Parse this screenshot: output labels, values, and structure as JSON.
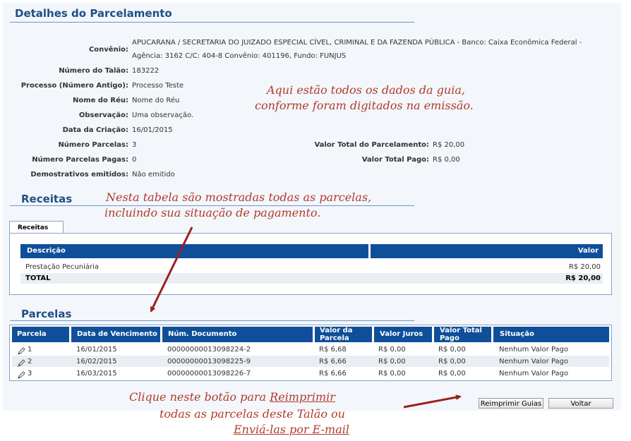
{
  "header": {
    "title": "Detalhes do Parcelamento"
  },
  "details": {
    "convenio_label": "Convênio:",
    "convenio_line1": "APUCARANA / SECRETARIA DO JUIZADO ESPECIAL CÍVEL, CRIMINAL E DA FAZENDA PÚBLICA - Banco: Caixa Econômica Federal -",
    "convenio_line2": "Agência: 3162 C/C: 404-8 Convênio: 401196, Fundo: FUNJUS",
    "talao_label": "Número do Talão:",
    "talao_value": "183222",
    "processo_label": "Processo (Número Antigo):",
    "processo_value": "Processo Teste",
    "reu_label": "Nome do Réu:",
    "reu_value": "Nome do Réu",
    "obs_label": "Observação:",
    "obs_value": "Uma observação.",
    "criacao_label": "Data da Criação:",
    "criacao_value": "16/01/2015",
    "parcelas_label": "Número Parcelas:",
    "parcelas_value": "3",
    "pagas_label": "Número Parcelas Pagas:",
    "pagas_value": "0",
    "demonstrativos_label": "Demostrativos emitidos:",
    "demonstrativos_value": "Não emitido",
    "valor_total_label": "Valor Total do Parcelamento:",
    "valor_total_value": "R$ 20,00",
    "valor_pago_label": "Valor Total Pago:",
    "valor_pago_value": "R$ 0,00"
  },
  "annotations": {
    "note1_line1": "Aqui estão todos os dados da guia,",
    "note1_line2": "conforme foram digitados na emissão.",
    "note2_line1": "Nesta tabela são mostradas todas as parcelas,",
    "note2_line2": "incluindo sua situação de pagamento.",
    "note3_line1": "Clique neste botão para ",
    "note3_line1_u": "Reimprimir",
    "note3_line2": "todas as  parcelas deste Talão ou",
    "note3_line3": "Enviá-las por E-mail",
    "accent": "#b03b2b"
  },
  "receitas": {
    "title": "Receitas",
    "tab_label": "Receitas",
    "col_descricao": "Descrição",
    "col_valor": "Valor",
    "row_desc": "Prestação Pecuniária",
    "row_valor": "R$ 20,00",
    "total_label": "TOTAL",
    "total_valor": "R$ 20,00"
  },
  "parcelas": {
    "title": "Parcelas",
    "columns": [
      "Parcela",
      "Data de Vencimento",
      "Núm. Documento",
      "Valor da Parcela",
      "Valor Juros",
      "Valor Total Pago",
      "Situação"
    ],
    "rows": [
      {
        "num": "1",
        "venc": "16/01/2015",
        "doc": "00000000013098224-2",
        "valor": "R$ 6,68",
        "juros": "R$ 0,00",
        "pago": "R$ 0,00",
        "situacao": "Nenhum Valor Pago"
      },
      {
        "num": "2",
        "venc": "16/02/2015",
        "doc": "00000000013098225-9",
        "valor": "R$ 6,66",
        "juros": "R$ 0,00",
        "pago": "R$ 0,00",
        "situacao": "Nenhum Valor Pago"
      },
      {
        "num": "3",
        "venc": "16/03/2015",
        "doc": "00000000013098226-7",
        "valor": "R$ 6,66",
        "juros": "R$ 0,00",
        "pago": "R$ 0,00",
        "situacao": "Nenhum Valor Pago"
      }
    ],
    "row_icon": "edit-pencil-icon"
  },
  "buttons": {
    "reimprimir": "Reimprimir Guias",
    "voltar": "Voltar"
  },
  "colors": {
    "title": "#1f4f86",
    "table_header": "#0f4f9a",
    "panel_bg": "#f3f6fb"
  }
}
